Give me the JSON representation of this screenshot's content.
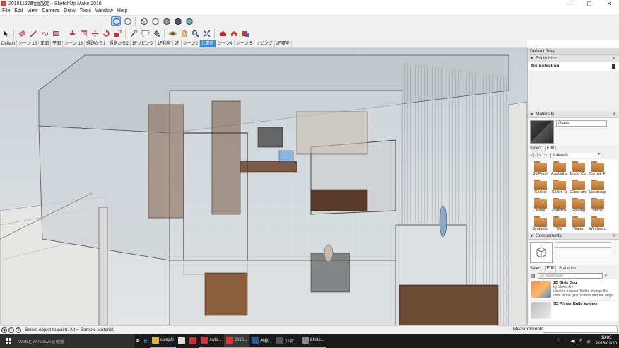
{
  "window": {
    "title": "20101122断面設定 - SketchUp Make 2016",
    "min": "—",
    "max": "☐",
    "close": "✕"
  },
  "menu": [
    "File",
    "Edit",
    "View",
    "Camera",
    "Draw",
    "Tools",
    "Window",
    "Help"
  ],
  "scenes": [
    {
      "label": "Default",
      "active": false
    },
    {
      "label": "シーン 15",
      "active": false
    },
    {
      "label": "正面",
      "active": false
    },
    {
      "label": "平面",
      "active": false
    },
    {
      "label": "シーン 16",
      "active": false
    },
    {
      "label": "通路から1",
      "active": false
    },
    {
      "label": "通路から2",
      "active": false
    },
    {
      "label": "1Fリビング",
      "active": false
    },
    {
      "label": "1F和室",
      "active": false
    },
    {
      "label": "2F",
      "active": false
    },
    {
      "label": "シーン2",
      "active": false
    },
    {
      "label": "仕業所",
      "active": true
    },
    {
      "label": "シーン4",
      "active": false
    },
    {
      "label": "シーン 5",
      "active": false
    },
    {
      "label": "リビング",
      "active": false
    },
    {
      "label": "2F寝室",
      "active": false
    }
  ],
  "tray": {
    "title": "Default Tray",
    "entity_info": {
      "header": "Entity Info",
      "selection": "No Selection"
    },
    "materials": {
      "header": "Materials",
      "current_name": "Glass",
      "tab_select": "Select",
      "tab_edit": "Edit",
      "library": "Materials",
      "items": [
        "3d Printi",
        "Asphalt a",
        "Brick, Cla",
        "Carpet, F",
        "Colors",
        "Colors-N",
        "Glass anc",
        "Landscap",
        "Metal",
        "Patterns",
        "Roofing",
        "Stone",
        "Synthetic",
        "Tile",
        "Water",
        "Window c"
      ]
    },
    "components": {
      "header": "Components",
      "tab_select": "Select",
      "tab_edit": "Edit",
      "tab_statistics": "Statistics",
      "search_placeholder": "3D Warehouse",
      "entries": [
        {
          "title": "2D Girls Dog",
          "by": "by SketchUp",
          "desc": "Use the Interact Tool to change the color of the girls' clothes and the dog's fur"
        },
        {
          "title": "3D Printer Build Volume",
          "by": "",
          "desc": ""
        }
      ]
    }
  },
  "status": {
    "message": "Select object to paint. Alt = Sample Material.",
    "measurements_label": "Measurements"
  },
  "taskbar": {
    "search_placeholder": "WebとWindowsを検索",
    "apps": [
      {
        "label": "sample",
        "color": "#e0b040"
      },
      {
        "label": "Auto...",
        "color": "#c33"
      },
      {
        "label": "2010...",
        "color": "#d33"
      },
      {
        "label": "名称...",
        "color": "#2b5797"
      },
      {
        "label": "02初...",
        "color": "#555"
      },
      {
        "label": "Sketc...",
        "color": "#888"
      }
    ],
    "ime": "A",
    "lang": "あ",
    "time": "18:03",
    "date": "2016/01/20"
  },
  "colors": {
    "accent": "#3b8ad9",
    "folder": "#c4823e"
  }
}
